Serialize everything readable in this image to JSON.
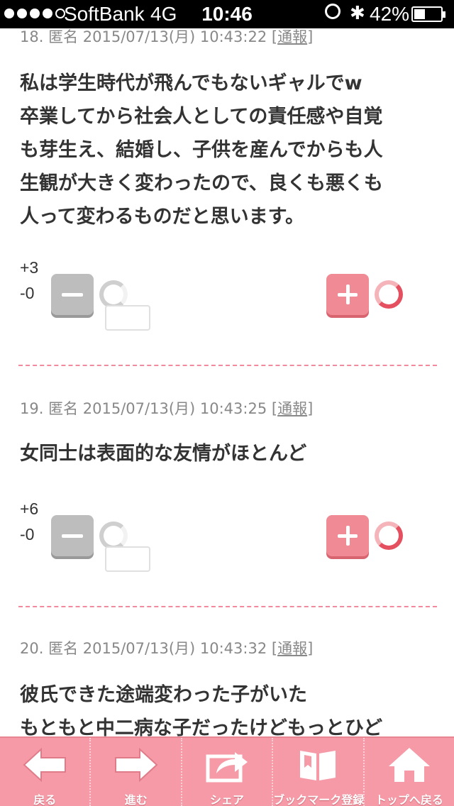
{
  "status_bar": {
    "carrier": "SoftBank",
    "network": "4G",
    "time": "10:46",
    "battery_percent": "42%",
    "battery_level": 0.42,
    "signal_bars": 4
  },
  "comments": [
    {
      "number": "18.",
      "name": "匿名",
      "datetime": "2015/07/13(月) 10:43:22",
      "report_label": "通報",
      "lines": [
        "私は学生時代が飛んでもないギャルでw",
        "卒業してから社会人としての責任感や自覚",
        "も芽生え、結婚し、子供を産んでからも人",
        "生観が大きく変わったので、良くも悪くも",
        "人って変わるものだと思います。"
      ],
      "plus": "+3",
      "minus": "-0"
    },
    {
      "number": "19.",
      "name": "匿名",
      "datetime": "2015/07/13(月) 10:43:25",
      "report_label": "通報",
      "lines": [
        "女同士は表面的な友情がほとんど"
      ],
      "plus": "+6",
      "minus": "-0"
    },
    {
      "number": "20.",
      "name": "匿名",
      "datetime": "2015/07/13(月) 10:43:32",
      "report_label": "通報",
      "lines": [
        "彼氏できた途端変わった子がいた",
        "もともと中二病な子だったけどもっとひど"
      ]
    }
  ],
  "toolbar": {
    "back": "戻る",
    "forward": "進む",
    "share": "シェア",
    "bookmark": "ブックマーク登録",
    "top": "トップへ戻る"
  },
  "icons": {
    "back": "arrow-left-icon",
    "forward": "arrow-right-icon",
    "share": "share-icon",
    "bookmark": "book-icon",
    "top": "home-icon"
  },
  "colors": {
    "accent": "#f08a94",
    "toolbar": "#f59aa6",
    "divider": "#f08a9c"
  }
}
